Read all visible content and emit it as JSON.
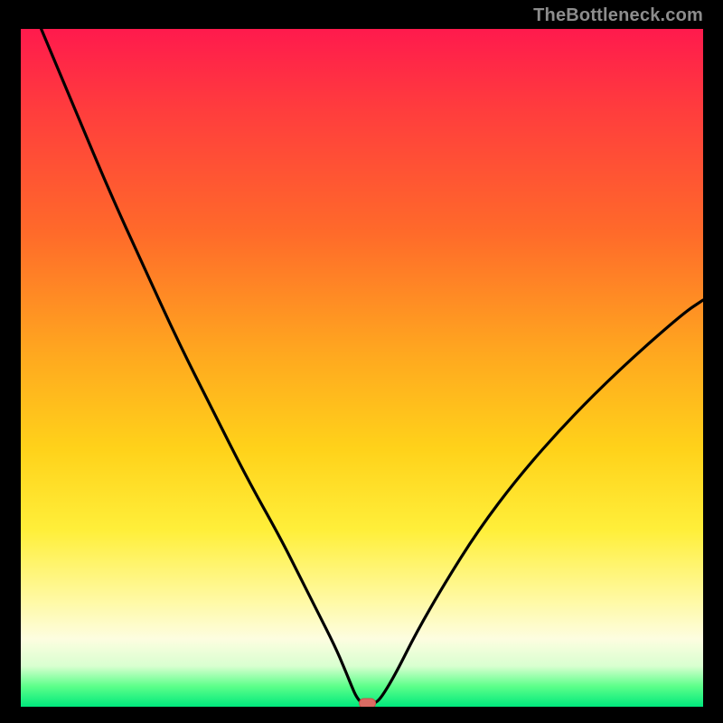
{
  "watermark": "TheBottleneck.com",
  "colors": {
    "frame": "#000000",
    "curve": "#000000",
    "marker_fill": "#d96b63",
    "marker_stroke": "#c84f47",
    "gradient_stops": [
      "#ff1a4d",
      "#ff3d3d",
      "#ff6a2a",
      "#ffa81f",
      "#ffd21a",
      "#ffef3a",
      "#fff9a0",
      "#fdfde0",
      "#d9ffd0",
      "#5cff8a",
      "#00e87c"
    ]
  },
  "chart_data": {
    "type": "line",
    "title": "",
    "xlabel": "",
    "ylabel": "",
    "xlim": [
      0,
      100
    ],
    "ylim": [
      0,
      100
    ],
    "grid": false,
    "legend": false,
    "series": [
      {
        "name": "bottleneck-curve",
        "x": [
          3,
          8,
          13,
          18,
          23,
          28,
          33,
          38,
          41,
          43.5,
          46,
          47.5,
          48.5,
          49.2,
          50,
          51,
          52,
          53,
          55,
          58,
          62,
          67,
          73,
          80,
          88,
          97,
          100
        ],
        "y": [
          100,
          88,
          76,
          65,
          54,
          44,
          34,
          25,
          19,
          14,
          9,
          5.5,
          3,
          1.4,
          0.5,
          0.5,
          0.5,
          1.6,
          5,
          11,
          18,
          26,
          34,
          42,
          50,
          58,
          60
        ]
      }
    ],
    "annotations": [
      {
        "name": "optimal-marker",
        "shape": "pill",
        "x": 50.8,
        "y": 0.5,
        "width_pct": 2.4,
        "height_pct": 1.4
      }
    ]
  }
}
